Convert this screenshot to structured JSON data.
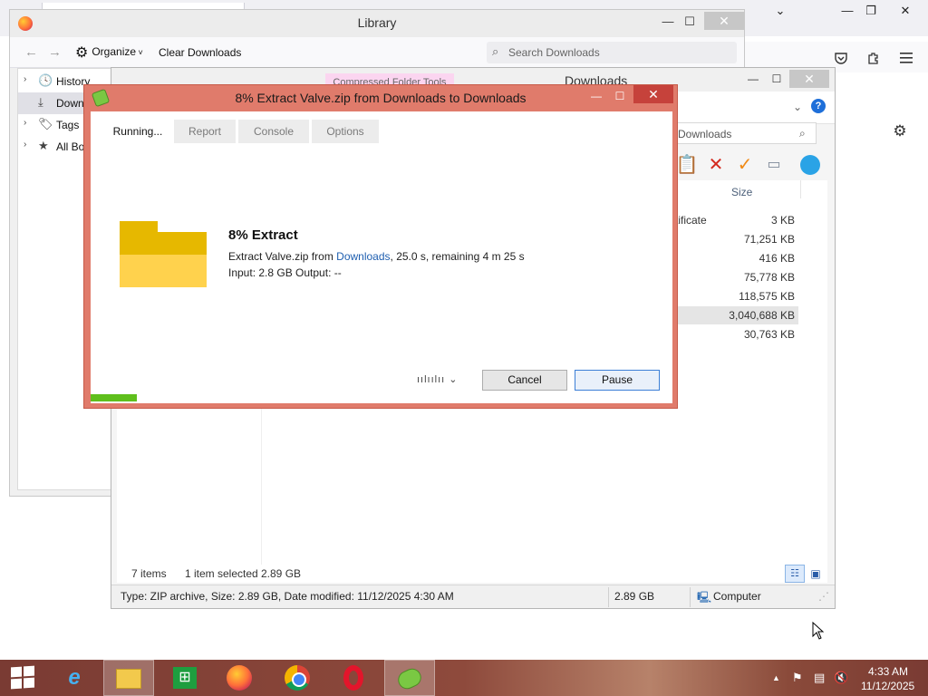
{
  "firefox": {
    "window_controls": {
      "minimize": "—",
      "restore": "❐",
      "close": "✕"
    },
    "tab_dropdown": "⌄",
    "toolbar_icons": [
      "pocket-icon",
      "extensions-icon",
      "menu-icon"
    ],
    "settings_icon": "⚙"
  },
  "library": {
    "title": "Library",
    "window_controls": {
      "minimize": "—",
      "maximize": "☐",
      "close": "✕"
    },
    "toolbar": {
      "back": "←",
      "forward": "→",
      "organize_label": "Organize",
      "clear_downloads_label": "Clear Downloads",
      "search_placeholder": "Search Downloads"
    },
    "tree": [
      {
        "arrow": "›",
        "icon": "🕓",
        "label": "History"
      },
      {
        "arrow": "",
        "icon": "⤓",
        "label": "Down"
      },
      {
        "arrow": "›",
        "icon": "🏷",
        "label": "Tags"
      },
      {
        "arrow": "›",
        "icon": "★",
        "label": "All Bo"
      }
    ]
  },
  "explorer": {
    "ribbon_tab": "Compressed Folder Tools",
    "title": "Downloads",
    "window_controls": {
      "minimize": "—",
      "maximize": "☐",
      "close": "✕"
    },
    "search_text": "Downloads",
    "column_size": "Size",
    "first_row_name_fragment": "rtificate",
    "sizes": [
      "3 KB",
      "71,251 KB",
      "416 KB",
      "75,778 KB",
      "118,575 KB",
      "3,040,688 KB",
      "30,763 KB"
    ],
    "selected_index": 5,
    "footer": {
      "items": "7 items",
      "selected": "1 item selected",
      "selected_size": "2.89 GB"
    },
    "status": {
      "details": "Type: ZIP archive, Size: 2.89 GB, Date modified: 11/12/2025 4:30 AM",
      "size": "2.89 GB",
      "location": "Computer"
    }
  },
  "peazip": {
    "title": "8% Extract Valve.zip from Downloads  to Downloads",
    "window_controls": {
      "minimize": "—",
      "maximize": "☐",
      "close": "✕"
    },
    "tabs": [
      {
        "label": "Running...",
        "active": true
      },
      {
        "label": "Report",
        "active": false
      },
      {
        "label": "Console",
        "active": false
      },
      {
        "label": "Options",
        "active": false
      }
    ],
    "operation_title": "8% Extract",
    "line1_prefix": "Extract Valve.zip from ",
    "line1_link": "Downloads",
    "line1_suffix": ", 25.0 s, remaining 4 m 25 s",
    "line2": "Input: 2.8 GB Output: --",
    "priority_dots": "ıılıılıı ⌄",
    "cancel_label": "Cancel",
    "pause_label": "Pause",
    "progress_fraction": 0.08,
    "colors": {
      "frame": "#e07b6b",
      "progress": "#5fbf1c",
      "folder": "#e6b800"
    }
  },
  "taskbar": {
    "apps": [
      "windows-start",
      "internet-explorer",
      "file-explorer",
      "store",
      "firefox",
      "chrome",
      "opera",
      "peazip"
    ],
    "tray": {
      "chevron": "▲",
      "flag": "⚑",
      "network": "▤",
      "volume": "🔇"
    },
    "time": "4:33 AM",
    "date": "11/12/2025"
  }
}
